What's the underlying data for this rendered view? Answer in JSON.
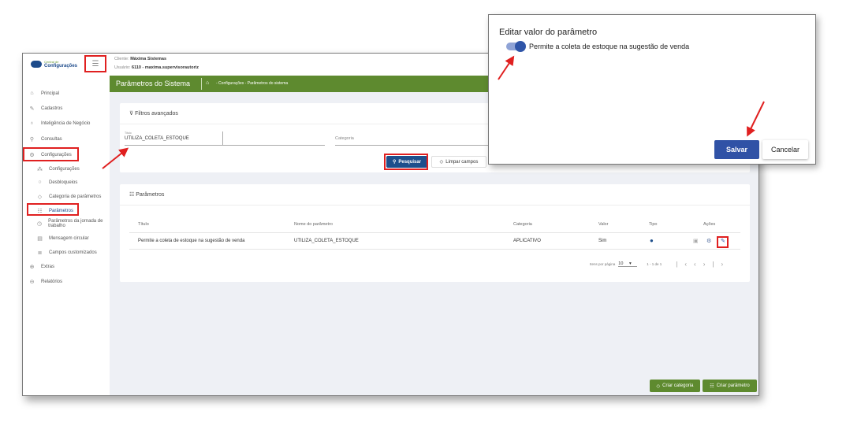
{
  "app": {
    "logo_small": "Central de",
    "logo_big": "Configurações",
    "client_label": "Cliente:",
    "client": "Máxima Sistemas",
    "user_label": "Usuário:",
    "user": "6110 - maxima.supervisorautoriz"
  },
  "header": {
    "title": "Parâmetros do Sistema",
    "breadcrumb": "- Configurações - Parâmetros do sistema"
  },
  "sidebar": {
    "items": [
      {
        "label": "Principal",
        "icon": "home-icon"
      },
      {
        "label": "Cadastros",
        "icon": "edit-icon"
      },
      {
        "label": "Inteligência de Negócio",
        "icon": "bulb-icon"
      },
      {
        "label": "Consultas",
        "icon": "search-icon"
      },
      {
        "label": "Configurações",
        "icon": "gear-icon"
      },
      {
        "label": "Configurações",
        "icon": "sitemap-icon"
      },
      {
        "label": "Desbloqueios",
        "icon": "unlock-icon"
      },
      {
        "label": "Categoria de parâmetros",
        "icon": "tag-icon"
      },
      {
        "label": "Parâmetros",
        "icon": "list-icon"
      },
      {
        "label": "Parâmetros da jornada de trabalho",
        "icon": "clock-icon"
      },
      {
        "label": "Mensagem circular",
        "icon": "message-icon"
      },
      {
        "label": "Campos customizados",
        "icon": "fields-icon"
      },
      {
        "label": "Extras",
        "icon": "plus-icon"
      },
      {
        "label": "Relatórios",
        "icon": "report-icon"
      }
    ]
  },
  "filters": {
    "title": "Filtros avançados",
    "title_label": "Título",
    "title_value": "UTILIZA_COLETA_ESTOQUE",
    "category_placeholder": "Categoria",
    "search": "Pesquisar",
    "clear": "Limpar campos"
  },
  "params": {
    "title": "Parâmetros",
    "columns": [
      "Título",
      "Nome do parâmetro",
      "Categoria",
      "Valor",
      "Tipo",
      "Ações"
    ],
    "rows": [
      {
        "titulo": "Permite a coleta de estoque na sugestão de venda",
        "nome": "UTILIZA_COLETA_ESTOQUE",
        "categoria": "APLICATIVO",
        "valor": "Sim"
      }
    ],
    "per_page_label": "Itens por página",
    "per_page": "10",
    "range": "1 - 1 de 1"
  },
  "footer": {
    "create_category": "Criar categoria",
    "create_param": "Criar parâmetro"
  },
  "modal": {
    "title": "Editar valor do parâmetro",
    "toggle_label": "Permite a coleta de estoque na sugestão de venda",
    "toggle_on": true,
    "save": "Salvar",
    "cancel": "Cancelar"
  },
  "colors": {
    "green": "#5e8a2f",
    "blue": "#3355aa",
    "annotation": "#e02020"
  }
}
